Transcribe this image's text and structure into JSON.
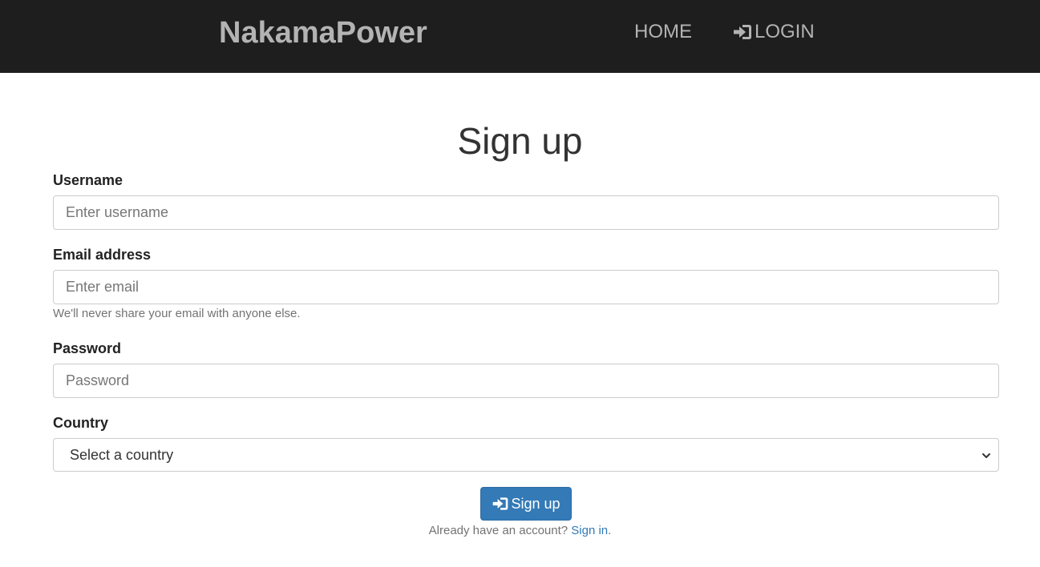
{
  "navbar": {
    "brand": "NakamaPower",
    "home_label": "HOME",
    "login_label": "LOGIN",
    "login_icon": "log-in-icon",
    "background": "#1e1e1e",
    "text_color": "#b3b3b3"
  },
  "form": {
    "title": "Sign up",
    "username": {
      "label": "Username",
      "placeholder": "Enter username"
    },
    "email": {
      "label": "Email address",
      "placeholder": "Enter email",
      "help": "We'll never share your email with anyone else."
    },
    "password": {
      "label": "Password",
      "placeholder": "Password"
    },
    "country": {
      "label": "Country",
      "selected": "Select a country",
      "icon": "chevron-down-icon"
    },
    "submit": {
      "label": "Sign up",
      "icon": "log-in-icon",
      "color": "#337ab7"
    },
    "signin_prompt": "Already have an account?",
    "signin_link": "Sign in",
    "signin_suffix": "."
  }
}
